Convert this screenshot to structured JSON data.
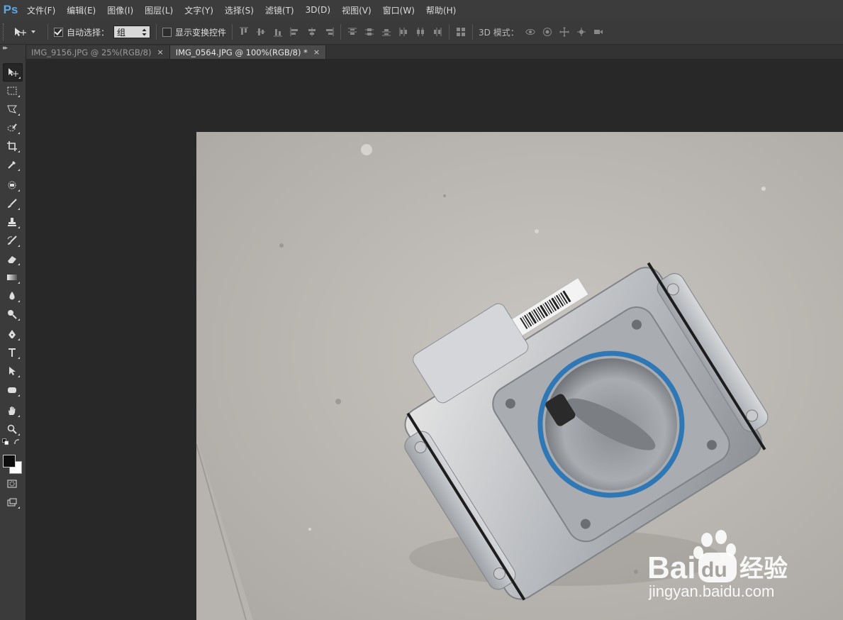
{
  "app": {
    "logo": "Ps"
  },
  "menu": [
    "文件(F)",
    "编辑(E)",
    "图像(I)",
    "图层(L)",
    "文字(Y)",
    "选择(S)",
    "滤镜(T)",
    "3D(D)",
    "视图(V)",
    "窗口(W)",
    "帮助(H)"
  ],
  "options": {
    "auto_select_label": "自动选择：",
    "auto_select_checked": true,
    "auto_select_value": "组",
    "show_transform_label": "显示变换控件",
    "show_transform_checked": false,
    "threed_mode_label": "3D 模式："
  },
  "tabs": [
    {
      "label": "IMG_9156.JPG @ 25%(RGB/8)",
      "close": "×",
      "active": false
    },
    {
      "label": "IMG_0564.JPG @ 100%(RGB/8) *",
      "close": "×",
      "active": true
    }
  ],
  "toolbar": {
    "grip": "▸▸",
    "tools": [
      "move-tool",
      "marquee-tool",
      "lasso-tool",
      "quick-selection-tool",
      "crop-tool",
      "eyedropper-tool",
      "healing-brush-tool",
      "brush-tool",
      "clone-stamp-tool",
      "history-brush-tool",
      "eraser-tool",
      "gradient-tool",
      "blur-tool",
      "dodge-tool",
      "pen-tool",
      "type-tool",
      "path-selection-tool",
      "shape-tool",
      "hand-tool",
      "zoom-tool"
    ],
    "foreground_color": "#0d0d0d",
    "background_color": "#ffffff"
  },
  "watermark": {
    "brand": "Bai",
    "brand_mark": "du",
    "product": "经验",
    "url": "jingyan.baidu.com"
  }
}
